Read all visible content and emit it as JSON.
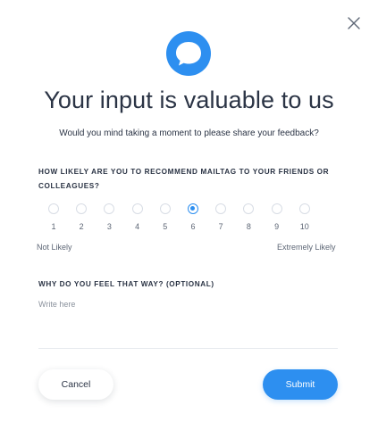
{
  "header": {
    "close_icon": "close-icon",
    "logo_icon": "chat-bubble-icon",
    "title": "Your input is valuable to us",
    "subtitle": "Would you mind taking a moment to please share your feedback?"
  },
  "question1": {
    "label": "HOW LIKELY ARE YOU TO RECOMMEND MAILTAG TO YOUR FRIENDS OR COLLEAGUES?",
    "options": [
      "1",
      "2",
      "3",
      "4",
      "5",
      "6",
      "7",
      "8",
      "9",
      "10"
    ],
    "selected": "6",
    "min_label": "Not Likely",
    "max_label": "Extremely Likely"
  },
  "question2": {
    "label": "WHY DO YOU FEEL THAT WAY? (OPTIONAL)",
    "placeholder": "Write here",
    "value": ""
  },
  "actions": {
    "cancel_label": "Cancel",
    "submit_label": "Submit"
  },
  "colors": {
    "accent": "#2d8ff0",
    "text": "#2b3445"
  }
}
